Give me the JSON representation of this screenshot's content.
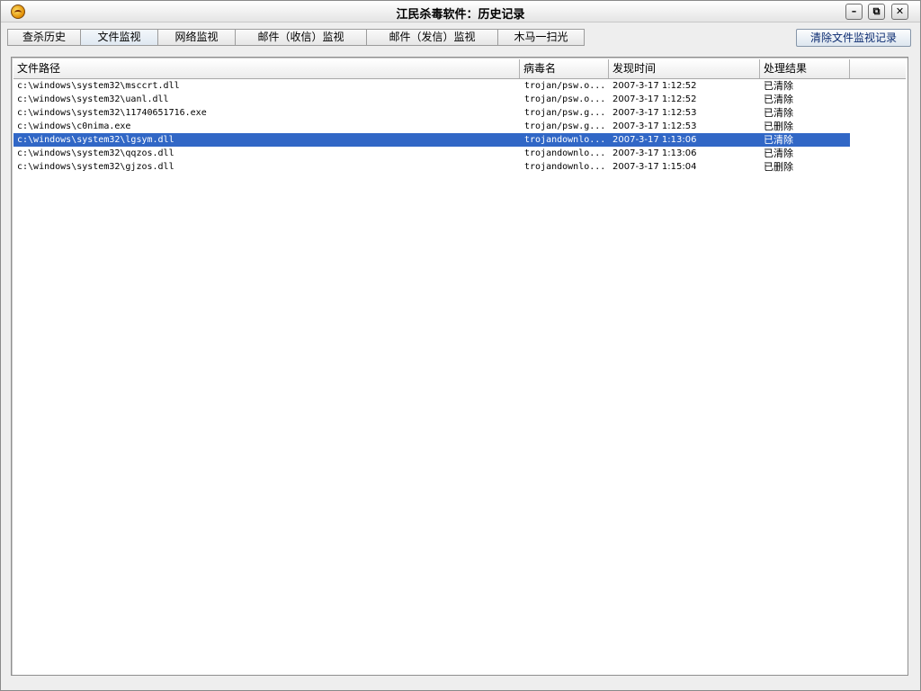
{
  "window": {
    "title": "江民杀毒软件：历史记录",
    "min_label": "–",
    "restore_label": "⧉",
    "close_label": "✕"
  },
  "tabs": [
    {
      "label": "查杀历史",
      "active": false
    },
    {
      "label": "文件监视",
      "active": true
    },
    {
      "label": "网络监视",
      "active": false
    },
    {
      "label": "邮件（收信）监视",
      "active": false
    },
    {
      "label": "邮件（发信）监视",
      "active": false
    },
    {
      "label": "木马一扫光",
      "active": false
    }
  ],
  "toolbar": {
    "clear_label": "清除文件监视记录"
  },
  "table": {
    "columns": [
      "文件路径",
      "病毒名",
      "发现时间",
      "处理结果"
    ],
    "selected_index": 4,
    "rows": [
      {
        "path": "c:\\windows\\system32\\msccrt.dll",
        "virus": "trojan/psw.o...",
        "time": "2007-3-17 1:12:52",
        "result": "已清除"
      },
      {
        "path": "c:\\windows\\system32\\uanl.dll",
        "virus": "trojan/psw.o...",
        "time": "2007-3-17 1:12:52",
        "result": "已清除"
      },
      {
        "path": "c:\\windows\\system32\\11740651716.exe",
        "virus": "trojan/psw.g...",
        "time": "2007-3-17 1:12:53",
        "result": "已清除"
      },
      {
        "path": "c:\\windows\\c0nima.exe",
        "virus": "trojan/psw.g...",
        "time": "2007-3-17 1:12:53",
        "result": "已删除"
      },
      {
        "path": "c:\\windows\\system32\\lgsym.dll",
        "virus": "trojandownlo...",
        "time": "2007-3-17 1:13:06",
        "result": "已清除"
      },
      {
        "path": "c:\\windows\\system32\\qqzos.dll",
        "virus": "trojandownlo...",
        "time": "2007-3-17 1:13:06",
        "result": "已清除"
      },
      {
        "path": "c:\\windows\\system32\\gjzos.dll",
        "virus": "trojandownlo...",
        "time": "2007-3-17 1:15:04",
        "result": "已删除"
      }
    ]
  },
  "colors": {
    "selection": "#3167c6",
    "window_bg": "#eeeeee",
    "button_text": "#0a2a70"
  }
}
